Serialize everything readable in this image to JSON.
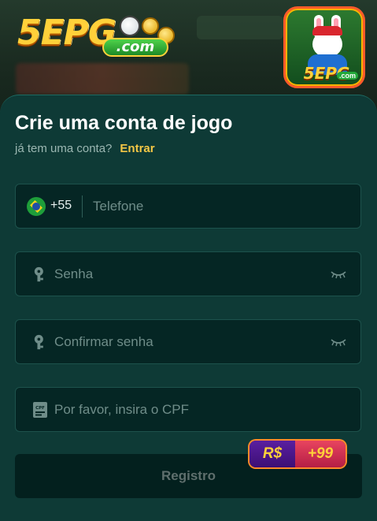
{
  "header": {
    "logo_text": "5EPG",
    "logo_com": ".com",
    "app_icon_text": "5EPG",
    "app_icon_com": ".com"
  },
  "form": {
    "title": "Crie uma conta de jogo",
    "have_account": "já tem uma conta?",
    "login_link": "Entrar",
    "phone": {
      "country_code": "+55",
      "placeholder": "Telefone",
      "flag_icon": "brazil-flag-icon"
    },
    "password": {
      "placeholder": "Senha",
      "icon": "key-icon",
      "toggle_icon": "eye-closed-icon"
    },
    "confirm_password": {
      "placeholder": "Confirmar senha",
      "icon": "key-icon",
      "toggle_icon": "eye-closed-icon"
    },
    "cpf": {
      "placeholder": "Por favor, insira o CPF",
      "icon": "cpf-card-icon"
    },
    "register_label": "Registro",
    "bonus": {
      "currency": "R$",
      "amount": "+99"
    }
  },
  "colors": {
    "card_bg": "#0e3a36",
    "field_bg": "#052624",
    "accent_link": "#f3c745",
    "bonus_purple": "#3c0f75",
    "bonus_red": "#b51e45"
  }
}
